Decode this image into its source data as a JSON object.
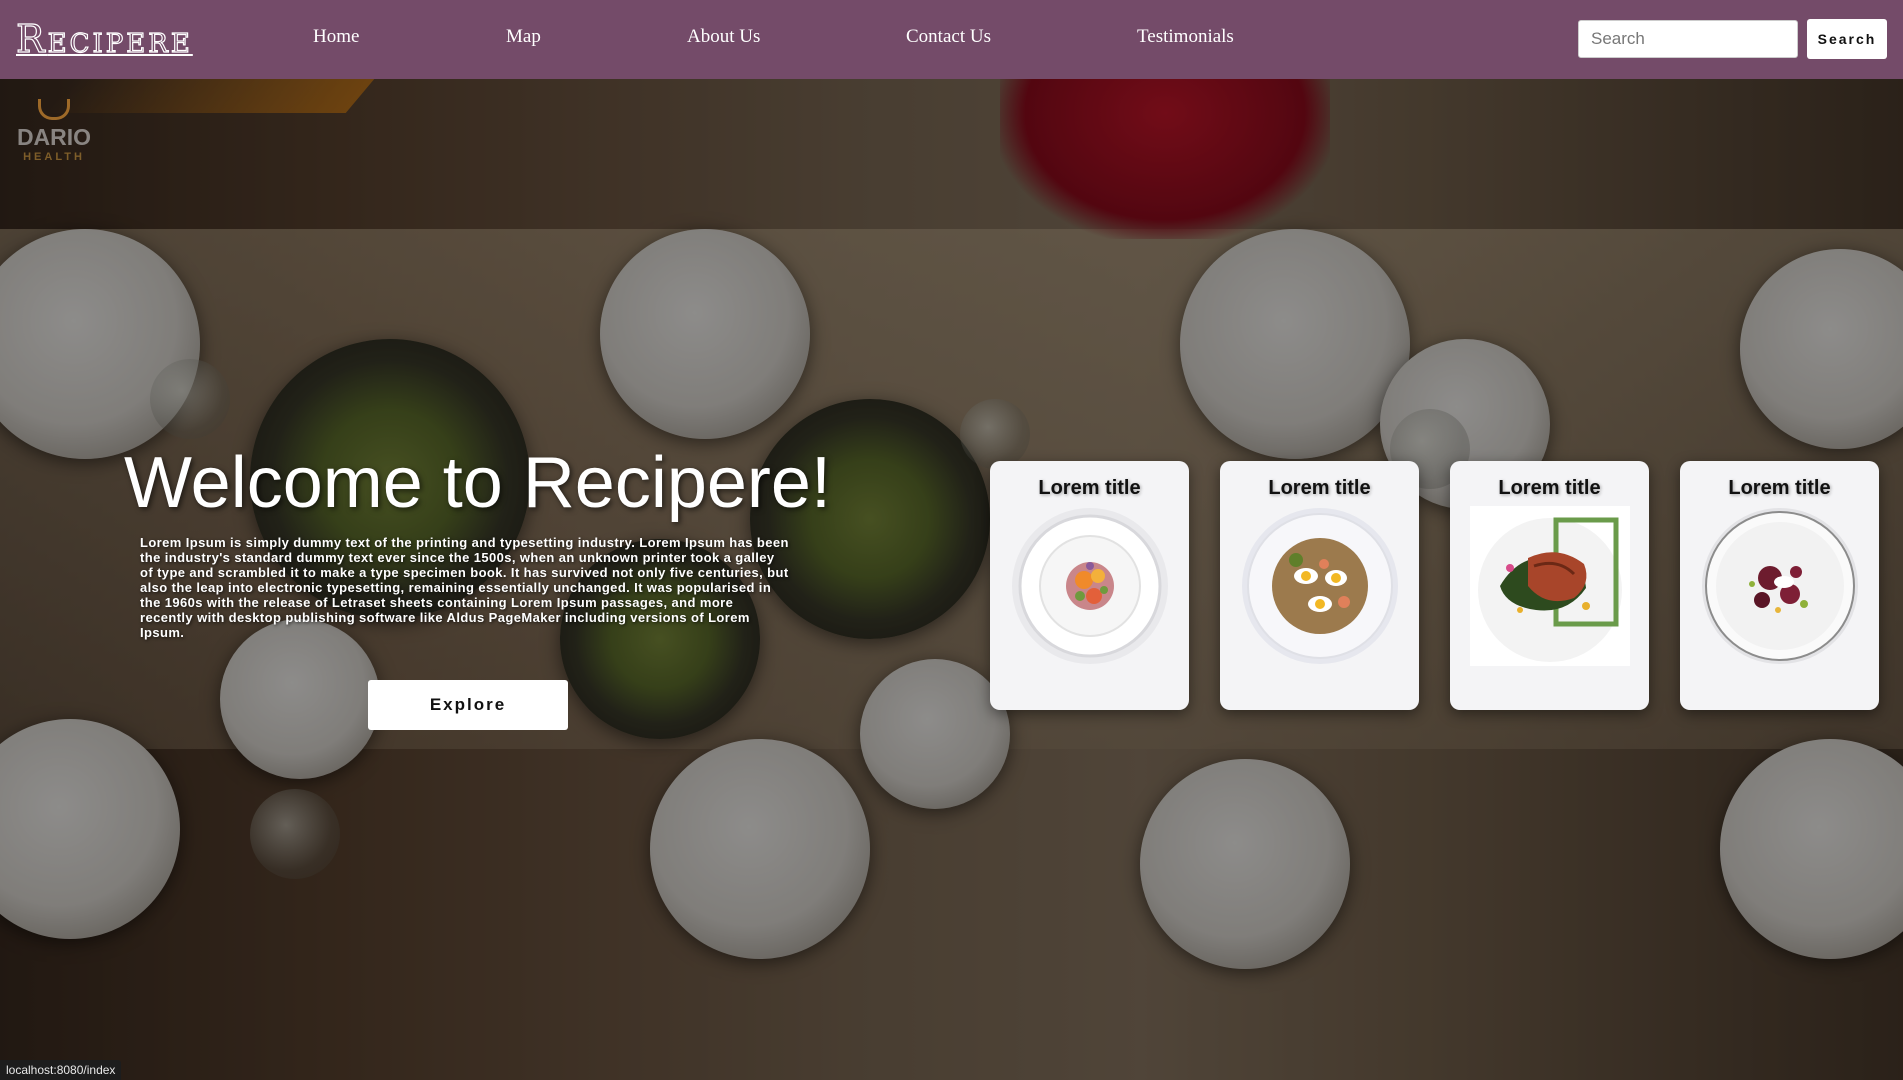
{
  "navbar": {
    "logo": "Recipere",
    "links": [
      {
        "label": "Home"
      },
      {
        "label": "Map"
      },
      {
        "label": "About Us"
      },
      {
        "label": "Contact Us"
      },
      {
        "label": "Testimonials"
      }
    ],
    "search": {
      "placeholder": "Search",
      "value": "",
      "button_label": "Search"
    },
    "colors": {
      "background": "#744b69"
    }
  },
  "hero": {
    "title": "Welcome to Recipere!",
    "text": "Lorem Ipsum is simply dummy text of the printing and typesetting industry. Lorem Ipsum has been the industry's standard dummy text ever since the 1500s, when an unknown printer took a galley of type and scrambled it to make a type specimen book. It has survived not only five centuries, but also the leap into electronic typesetting, remaining essentially unchanged. It was popularised in the 1960s with the release of Letraset sheets containing Lorem Ipsum passages, and more recently with desktop publishing software like Aldus PageMaker including versions of Lorem Ipsum.",
    "explore_label": "Explore",
    "background_logo": {
      "name": "DARIO",
      "sub": "HEALTH"
    }
  },
  "cards": [
    {
      "title": "Lorem title",
      "image": "plated-salad-orange-garnish"
    },
    {
      "title": "Lorem title",
      "image": "egg-salad-bowl"
    },
    {
      "title": "Lorem title",
      "image": "grilled-fish-with-greens"
    },
    {
      "title": "Lorem title",
      "image": "beetroot-plate"
    }
  ],
  "status_bar": {
    "url": "localhost:8080/index"
  }
}
